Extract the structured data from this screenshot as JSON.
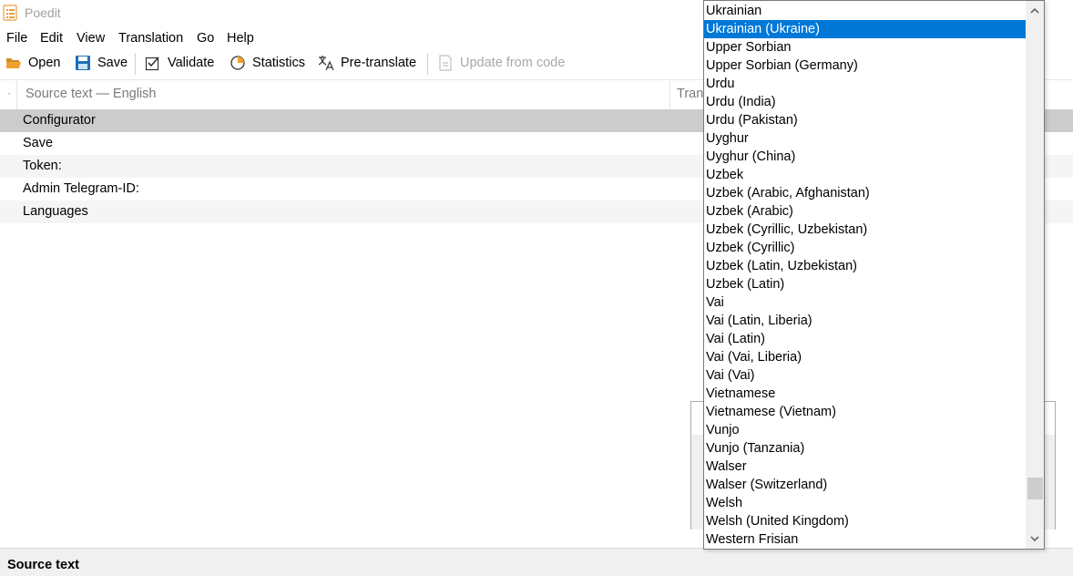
{
  "app": {
    "title": "Poedit"
  },
  "menu": [
    "File",
    "Edit",
    "View",
    "Translation",
    "Go",
    "Help"
  ],
  "toolbar": {
    "open": "Open",
    "save": "Save",
    "validate": "Validate",
    "statistics": "Statistics",
    "pretranslate": "Pre-translate",
    "update": "Update from code"
  },
  "list": {
    "header_source": "Source text — English",
    "header_translation": "Tran",
    "rows": [
      "Configurator",
      "Save",
      "Token:",
      "Admin Telegram-ID:",
      "Languages"
    ],
    "selected_index": 0
  },
  "status": {
    "label": "Source text"
  },
  "dropdown": {
    "selected_index": 1,
    "items": [
      "Ukrainian",
      "Ukrainian (Ukraine)",
      "Upper Sorbian",
      "Upper Sorbian (Germany)",
      "Urdu",
      "Urdu (India)",
      "Urdu (Pakistan)",
      "Uyghur",
      "Uyghur (China)",
      "Uzbek",
      "Uzbek (Arabic, Afghanistan)",
      "Uzbek (Arabic)",
      "Uzbek (Cyrillic, Uzbekistan)",
      "Uzbek (Cyrillic)",
      "Uzbek (Latin, Uzbekistan)",
      "Uzbek (Latin)",
      "Vai",
      "Vai (Latin, Liberia)",
      "Vai (Latin)",
      "Vai (Vai, Liberia)",
      "Vai (Vai)",
      "Vietnamese",
      "Vietnamese (Vietnam)",
      "Vunjo",
      "Vunjo (Tanzania)",
      "Walser",
      "Walser (Switzerland)",
      "Welsh",
      "Welsh (United Kingdom)",
      "Western Frisian"
    ],
    "scroll_position": 0.94
  },
  "colors": {
    "selection": "#0078d7",
    "row_selected": "#cccccc",
    "accent_orange": "#f0a030",
    "save_blue": "#1f6fb8"
  }
}
